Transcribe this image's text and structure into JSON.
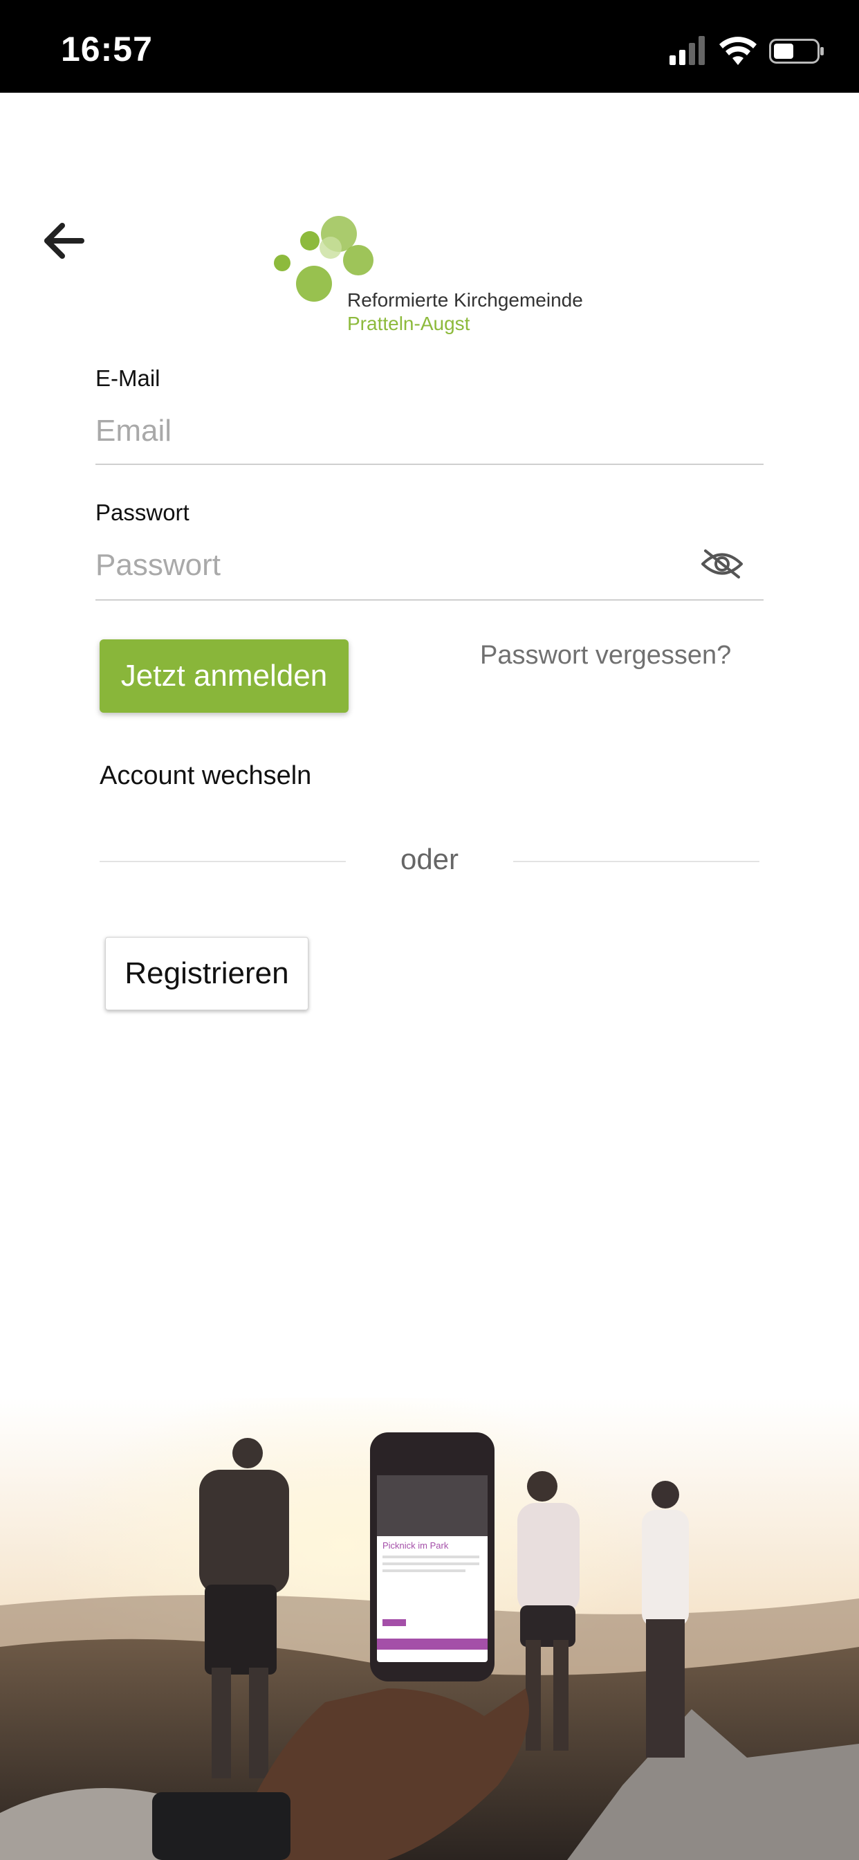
{
  "status_bar": {
    "time": "16:57"
  },
  "logo": {
    "line1": "Reformierte Kirchgemeinde",
    "line2": "Pratteln-Augst"
  },
  "form": {
    "email": {
      "label": "E-Mail",
      "placeholder": "Email",
      "value": ""
    },
    "password": {
      "label": "Passwort",
      "placeholder": "Passwort",
      "value": ""
    }
  },
  "actions": {
    "login_label": "Jetzt anmelden",
    "forgot_label": "Passwort vergessen?",
    "switch_account_label": "Account wechseln",
    "divider_label": "oder",
    "register_label": "Registrieren"
  },
  "hero": {
    "phone_card_title": "Picknick im Park"
  },
  "icons": {
    "back": "arrow-left-icon",
    "password_toggle": "eye-slash-icon"
  },
  "colors": {
    "accent_green": "#89b63a",
    "logo_green": "#8dba3c",
    "phone_card_accent": "#a44fa8"
  }
}
